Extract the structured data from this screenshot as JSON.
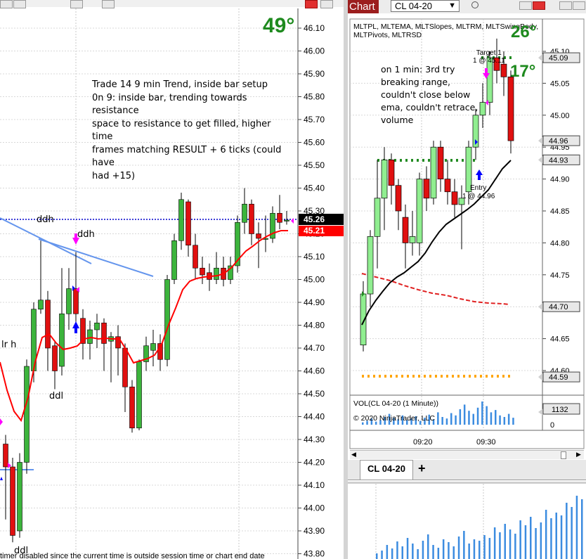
{
  "left_chart": {
    "angle_label": "49°",
    "annotation_lines": [
      "Trade 14 9 min Trend, inside bar setup",
      "0n 9: inside bar, trending towards resistance",
      "space to resistance to get filled, higher time",
      "frames matching RESULT + 6 ticks (could have",
      "had +15)"
    ],
    "labels": {
      "ddh_line": "ddh",
      "ddh_marker": "ddh",
      "ddl_mid": "ddl",
      "ddl_bottom": "ddl",
      "lrh": "lr h"
    },
    "price_ticks": [
      "46.10",
      "46.00",
      "45.90",
      "45.80",
      "45.70",
      "45.60",
      "45.50",
      "45.40",
      "45.30",
      "45.20",
      "45.10",
      "45.00",
      "44.90",
      "44.80",
      "44.70",
      "44.60",
      "44.50",
      "44.40",
      "44.30",
      "44.20",
      "44.10",
      "44.00",
      "43.90",
      "43.80"
    ],
    "last_price": "45.26",
    "ema_price": "45.21",
    "status_text": "timer disabled since the current time is outside session time or chart end date",
    "colors": {
      "up": "#3cb43c",
      "down": "#e01010",
      "ema": "#ff0000",
      "trend": "#6495ed",
      "ddh": "#0000cc",
      "marker": "#ff00ff"
    }
  },
  "right_window": {
    "title": "Chart",
    "instrument": "CL 04-20",
    "indicators_line1": "MLTPL, MLTEMA, MLTSlopes, MLTRM, MLTSwingBody,",
    "indicators_line2": "MLTPivots, MLTRSD",
    "angle_top": "26°",
    "angle_mid": "17°",
    "target_label_1": "Target 1",
    "target_label_2": "1 @ 45.11",
    "entry_label_1": "Entry",
    "entry_label_2": "1 @ 44.96",
    "annotation_lines": [
      "on 1 min: 3rd try",
      "breaking range,",
      "couldn't close below",
      "ema, couldn't retrace,",
      "volume"
    ],
    "price_ticks": [
      "45.10",
      "45.05",
      "45.00",
      "44.95",
      "44.90",
      "44.85",
      "44.80",
      "44.75",
      "44.70",
      "44.65",
      "44.60"
    ],
    "price_flags": [
      "45.09",
      "44.96",
      "44.93",
      "44.70",
      "44.59"
    ],
    "volume_title": "VOL(CL 04-20 (1 Minute))",
    "copyright": "© 2020 NinjaTrader, LLC",
    "volume_flag": "1132",
    "volume_zero": "0",
    "time_ticks": [
      "09:20",
      "09:30"
    ],
    "tab_label": "CL 04-20",
    "add_tab": "+"
  }
}
